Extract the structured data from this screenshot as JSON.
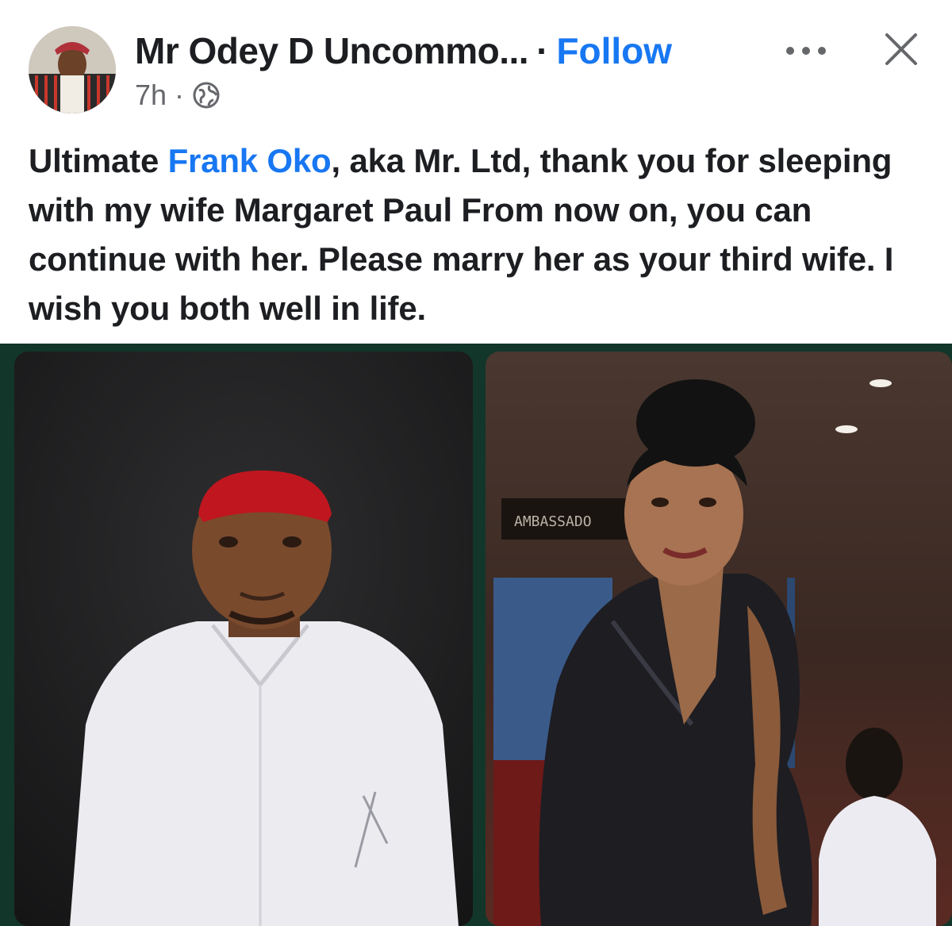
{
  "post": {
    "author_name": "Mr Odey D Uncommo...",
    "separator": "·",
    "follow_label": "Follow",
    "timestamp": "7h",
    "meta_separator": "·",
    "audience_icon": "globe-icon",
    "more_icon": "more-options-icon",
    "close_icon": "close-icon",
    "text_before_mention": "Ultimate ",
    "mention": "Frank Oko",
    "text_after_mention": ", aka Mr. Ltd, thank you for sleeping with my wife Margaret Paul From now on, you can continue with her. Please marry her as your third wife. I wish you both well in life."
  },
  "photo": {
    "sign_text": "AMBASSADO"
  },
  "colors": {
    "accent": "#1877f2",
    "text": "#1c1e21",
    "secondary_text": "#65676b",
    "frame_green": "#12362a"
  }
}
